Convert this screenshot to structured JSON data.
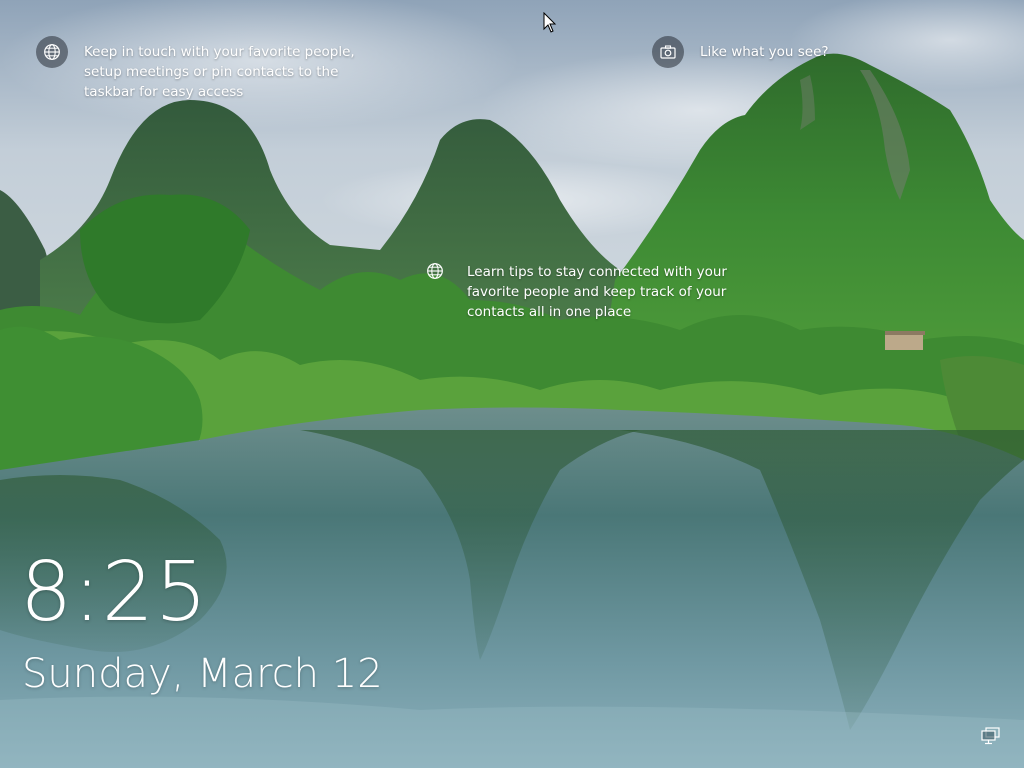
{
  "lockscreen": {
    "tips": [
      {
        "icon": "globe-icon",
        "text": "Keep in touch with your favorite people,\nsetup meetings or pin contacts to the\ntaskbar for easy access"
      },
      {
        "icon": "camera-icon",
        "text": "Like what you see?"
      },
      {
        "icon": "globe-icon",
        "text": "Learn tips to stay connected with your\nfavorite people and keep track of your\ncontacts all in one place"
      }
    ],
    "time": "8:25",
    "date": "Sunday, March 12",
    "network_icon": "network-icon"
  },
  "colors": {
    "sky": "#b9c9d6",
    "mountain_green": "#3f8a3a",
    "water": "#3e6f73",
    "text": "#ffffff"
  }
}
